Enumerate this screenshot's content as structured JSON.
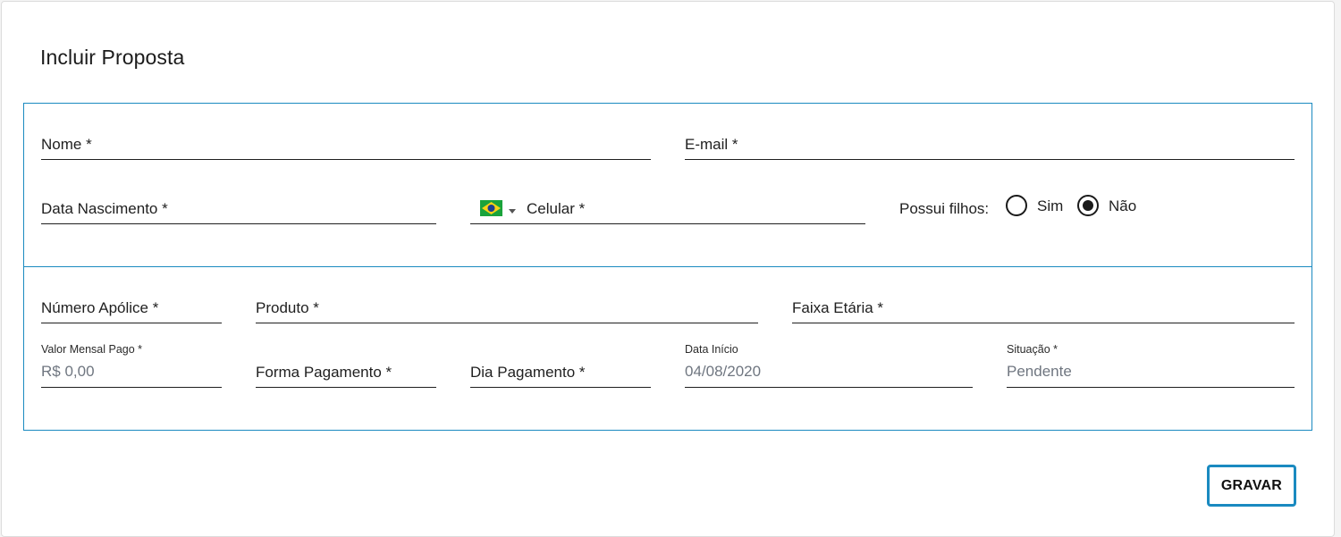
{
  "title": "Incluir Proposta",
  "fields": {
    "nome": {
      "label": "Nome *"
    },
    "email": {
      "label": "E-mail *"
    },
    "data_nascimento": {
      "label": "Data Nascimento *"
    },
    "celular": {
      "label": "Celular *",
      "country_flag": "brazil-flag-icon"
    },
    "numero_apolice": {
      "label": "Número Apólice *"
    },
    "produto": {
      "label": "Produto *"
    },
    "faixa_etaria": {
      "label": "Faixa Etária *"
    },
    "valor_mensal": {
      "label": "Valor Mensal Pago *",
      "value": "R$ 0,00"
    },
    "forma_pagamento": {
      "label": "Forma Pagamento *"
    },
    "dia_pagamento": {
      "label": "Dia Pagamento *"
    },
    "data_inicio": {
      "label": "Data Início",
      "value": "04/08/2020"
    },
    "situacao": {
      "label": "Situação *",
      "value": "Pendente"
    }
  },
  "possui_filhos": {
    "question": "Possui filhos:",
    "options": [
      {
        "label": "Sim",
        "checked": false
      },
      {
        "label": "Não",
        "checked": true
      }
    ]
  },
  "actions": {
    "save_label": "GRAVAR"
  },
  "colors": {
    "accent": "#1a8ac0",
    "text": "#1f1f1f",
    "muted_value": "#6f7680"
  }
}
